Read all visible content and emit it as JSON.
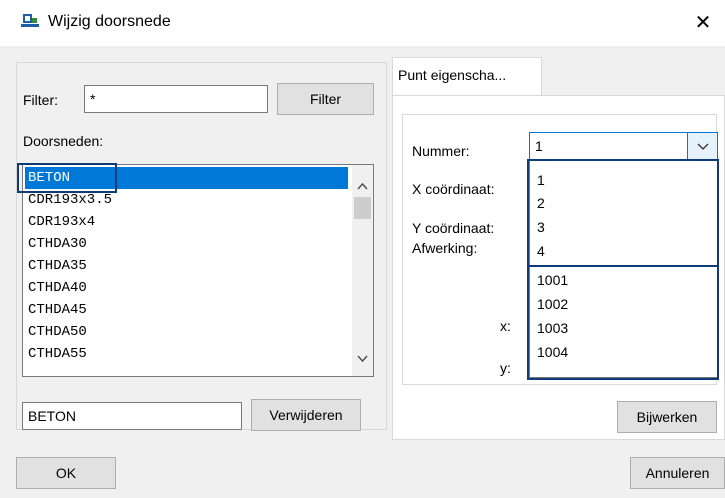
{
  "window": {
    "title": "Wijzig doorsnede",
    "close_glyph": "✕",
    "accent": "#0078d7"
  },
  "left": {
    "filter_label": "Filter:",
    "filter_value": "*",
    "filter_button": "Filter",
    "list_label": "Doorsneden:",
    "items": [
      "BETON",
      "CDR193x3.5",
      "CDR193x4",
      "CTHDA30",
      "CTHDA35",
      "CTHDA40",
      "CTHDA45",
      "CTHDA50",
      "CTHDA55"
    ],
    "selected_index": 0,
    "selected_value": "BETON",
    "delete_button": "Verwijderen"
  },
  "right": {
    "tab_label": "Punt eigenscha...",
    "nummer_label": "Nummer:",
    "nummer_value": "1",
    "x_label": "X coördinaat:",
    "y_label": "Y coördinaat:",
    "afwerking_label": "Afwerking:",
    "x_small_label": "x:",
    "y_small_label": "y:",
    "dropdown_options": [
      "1",
      "2",
      "3",
      "4",
      "1001",
      "1002",
      "1003",
      "1004"
    ],
    "update_button": "Bijwerken"
  },
  "footer": {
    "ok_button": "OK",
    "cancel_button": "Annuleren"
  }
}
